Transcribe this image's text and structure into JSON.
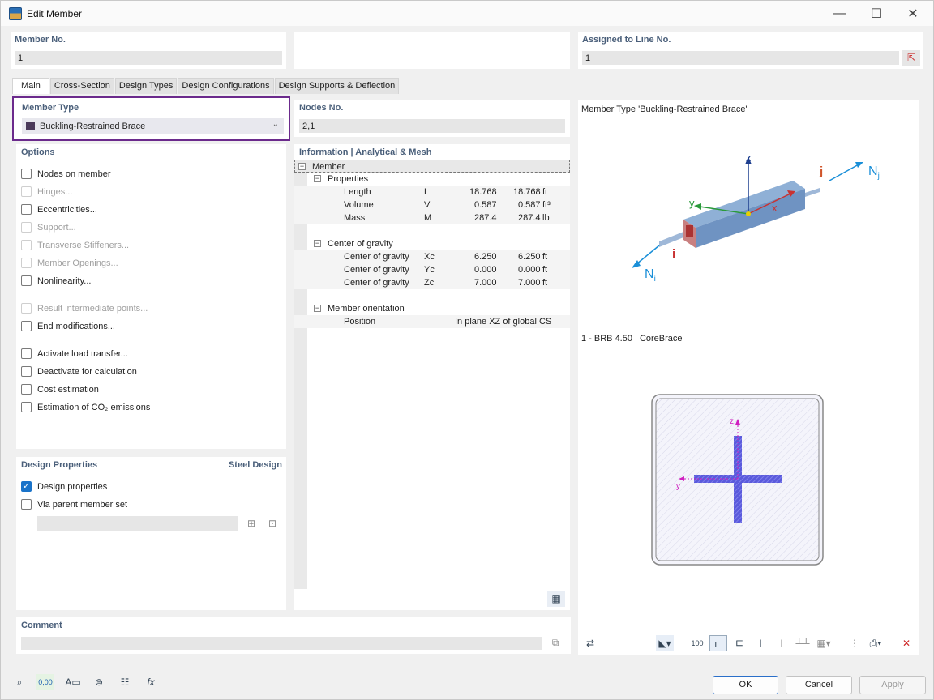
{
  "window": {
    "title": "Edit Member"
  },
  "header": {
    "member_no_label": "Member No.",
    "member_no_value": "1",
    "assigned_label": "Assigned to Line No.",
    "assigned_value": "1"
  },
  "tabs": [
    "Main",
    "Cross-Section",
    "Design Types",
    "Design Configurations",
    "Design Supports & Deflection"
  ],
  "member_type": {
    "label": "Member Type",
    "value": "Buckling-Restrained Brace",
    "swatch_color": "#4b3a5a"
  },
  "options": {
    "label": "Options",
    "items": [
      {
        "label": "Nodes on member",
        "enabled": true
      },
      {
        "label": "Hinges...",
        "enabled": false
      },
      {
        "label": "Eccentricities...",
        "enabled": true
      },
      {
        "label": "Support...",
        "enabled": false
      },
      {
        "label": "Transverse Stiffeners...",
        "enabled": false
      },
      {
        "label": "Member Openings...",
        "enabled": false
      },
      {
        "label": "Nonlinearity...",
        "enabled": true
      },
      {
        "label": "Result intermediate points...",
        "enabled": false
      },
      {
        "label": "End modifications...",
        "enabled": true
      },
      {
        "label": "Activate load transfer...",
        "enabled": true
      },
      {
        "label": "Deactivate for calculation",
        "enabled": true
      },
      {
        "label": "Cost estimation",
        "enabled": true
      },
      {
        "label": "Estimation of CO₂ emissions",
        "enabled": true
      }
    ]
  },
  "design_properties": {
    "label": "Design Properties",
    "steel_label": "Steel Design",
    "design_properties_check": "Design properties",
    "via_parent": "Via parent member set"
  },
  "nodes": {
    "label": "Nodes No.",
    "value": "2,1"
  },
  "info": {
    "label": "Information | Analytical & Mesh",
    "member": "Member",
    "properties": "Properties",
    "rows": [
      {
        "name": "Length",
        "sym": "L",
        "v1": "18.768",
        "v2": "18.768",
        "unit": "ft"
      },
      {
        "name": "Volume",
        "sym": "V",
        "v1": "0.587",
        "v2": "0.587",
        "unit": "ft³"
      },
      {
        "name": "Mass",
        "sym": "M",
        "v1": "287.4",
        "v2": "287.4",
        "unit": "lb"
      }
    ],
    "cog": "Center of gravity",
    "cog_rows": [
      {
        "name": "Center of gravity",
        "sym": "Xc",
        "v1": "6.250",
        "v2": "6.250",
        "unit": "ft"
      },
      {
        "name": "Center of gravity",
        "sym": "Yc",
        "v1": "0.000",
        "v2": "0.000",
        "unit": "ft"
      },
      {
        "name": "Center of gravity",
        "sym": "Zc",
        "v1": "7.000",
        "v2": "7.000",
        "unit": "ft"
      }
    ],
    "orientation": "Member orientation",
    "position_label": "Position",
    "position_value": "In plane XZ of global CS"
  },
  "preview": {
    "title": "Member Type 'Buckling-Restrained Brace'",
    "section_title": "1 - BRB 4.50 | CoreBrace",
    "labels": {
      "z": "z",
      "y": "y",
      "x": "x",
      "i": "i",
      "j": "j",
      "Ni": "N",
      "Nj": "N",
      "sub_i": "i",
      "sub_j": "j"
    }
  },
  "comment": {
    "label": "Comment"
  },
  "buttons": {
    "ok": "OK",
    "cancel": "Cancel",
    "apply": "Apply"
  },
  "bottom_tools": [
    "search-icon",
    "units-icon",
    "text-icon",
    "view-icon",
    "list-icon",
    "function-icon"
  ],
  "units_text": "0,00",
  "fx_text": "fx",
  "scale_text": "100"
}
